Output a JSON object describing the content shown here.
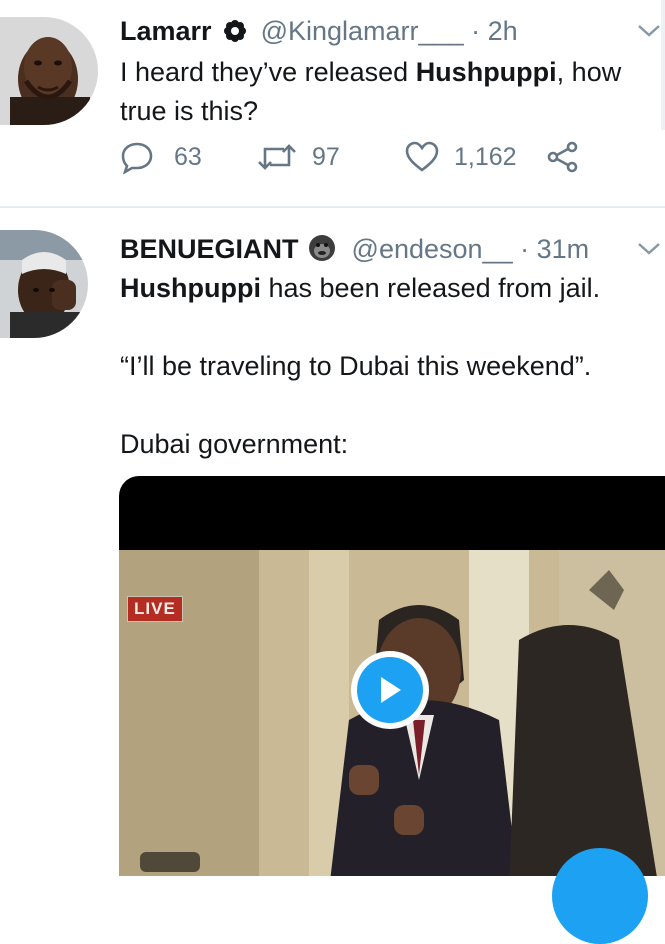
{
  "tweets": [
    {
      "name": "Lamarr",
      "handle": "@Kinglamarr___",
      "time": "· 2h",
      "text_before": "I heard they’ve released ",
      "text_bold": "Hushpuppi",
      "text_after": ", how",
      "text_line2": "true is this?",
      "replies": "63",
      "retweets": "97",
      "likes": "1,162"
    },
    {
      "name": "BENUEGIANT",
      "handle": "@endeson__",
      "time": "· 31m",
      "text_bold": "Hushpuppi",
      "text_after": " has been released from jail.",
      "quote_line": "“I’ll be traveling to Dubai this weekend”.",
      "gov_line": "Dubai government:",
      "live_label": "LIVE"
    }
  ],
  "colors": {
    "accent": "#1da1f2",
    "secondary_text": "#657786",
    "divider": "#e6ecf0"
  },
  "icons": {
    "verified": "flower-badge-icon",
    "emoji": "gorilla-emoji-icon",
    "reply": "reply-icon",
    "retweet": "retweet-icon",
    "like": "heart-icon",
    "share": "share-icon",
    "caret": "chevron-down-icon",
    "play": "play-icon"
  }
}
